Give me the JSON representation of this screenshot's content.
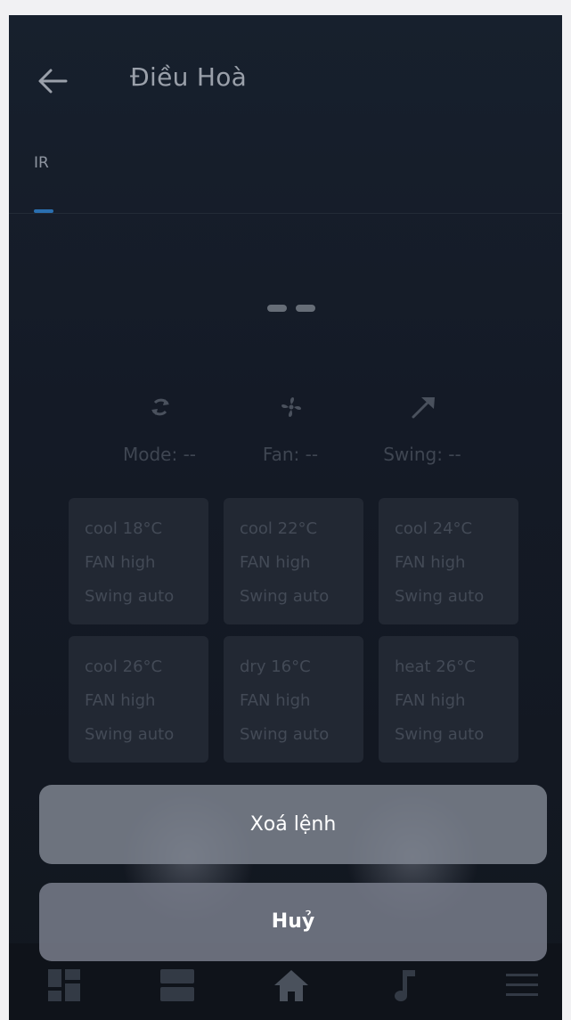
{
  "header": {
    "title": "Điều Hoà",
    "back_icon": "arrow-left-icon"
  },
  "tabs": [
    {
      "label": "IR",
      "active": true
    }
  ],
  "status": {
    "temperature_placeholder": "--",
    "mode_label": "Mode: --",
    "fan_label": "Fan: --",
    "swing_label": "Swing: --",
    "icons": [
      "sync-icon",
      "fan-icon",
      "swing-icon"
    ]
  },
  "presets": [
    {
      "mode": "cool 18°C",
      "fan": "FAN high",
      "swing": "Swing auto"
    },
    {
      "mode": "cool 22°C",
      "fan": "FAN high",
      "swing": "Swing auto"
    },
    {
      "mode": "cool 24°C",
      "fan": "FAN high",
      "swing": "Swing auto"
    },
    {
      "mode": "cool 26°C",
      "fan": "FAN high",
      "swing": "Swing auto"
    },
    {
      "mode": "dry 16°C",
      "fan": "FAN high",
      "swing": "Swing auto"
    },
    {
      "mode": "heat 26°C",
      "fan": "FAN high",
      "swing": "Swing auto"
    }
  ],
  "action_sheet": {
    "delete_label": "Xoá lệnh",
    "cancel_label": "Huỷ"
  },
  "bottom_nav": {
    "items": [
      "dashboard-icon",
      "list-icon",
      "home-icon",
      "music-icon",
      "menu-icon"
    ],
    "active_index": 2
  },
  "colors": {
    "background": "#141a26",
    "accent": "#2a6fb0",
    "card": "#222833",
    "sheet_button": "#80858f"
  }
}
